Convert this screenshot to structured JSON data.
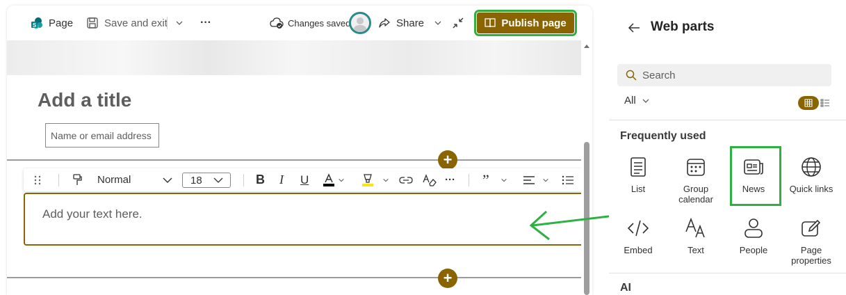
{
  "colors": {
    "accent": "#8a6400",
    "highlight": "#2eb142",
    "text": "#323130"
  },
  "cmdbar": {
    "page_label": "Page",
    "save_label": "Save and exit",
    "more_label": "···",
    "status_label": "Changes saved",
    "share_label": "Share",
    "publish_label": "Publish page"
  },
  "canvas": {
    "title_placeholder": "Add a title",
    "author_placeholder": "Name or email address",
    "text_placeholder": "Add your text here."
  },
  "toolbar": {
    "style_value": "Normal",
    "font_size_value": "18"
  },
  "panel": {
    "title": "Web parts",
    "search_placeholder": "Search",
    "filter_value": "All",
    "section_frequent": "Frequently used",
    "section_ai": "AI",
    "items": [
      {
        "label": "List",
        "icon": "list-icon"
      },
      {
        "label": "Group calendar",
        "icon": "calendar-icon"
      },
      {
        "label": "News",
        "icon": "news-icon"
      },
      {
        "label": "Quick links",
        "icon": "globe-icon"
      },
      {
        "label": "Embed",
        "icon": "code-icon"
      },
      {
        "label": "Text",
        "icon": "text-icon"
      },
      {
        "label": "People",
        "icon": "person-icon"
      },
      {
        "label": "Page properties",
        "icon": "edit-icon"
      }
    ]
  }
}
